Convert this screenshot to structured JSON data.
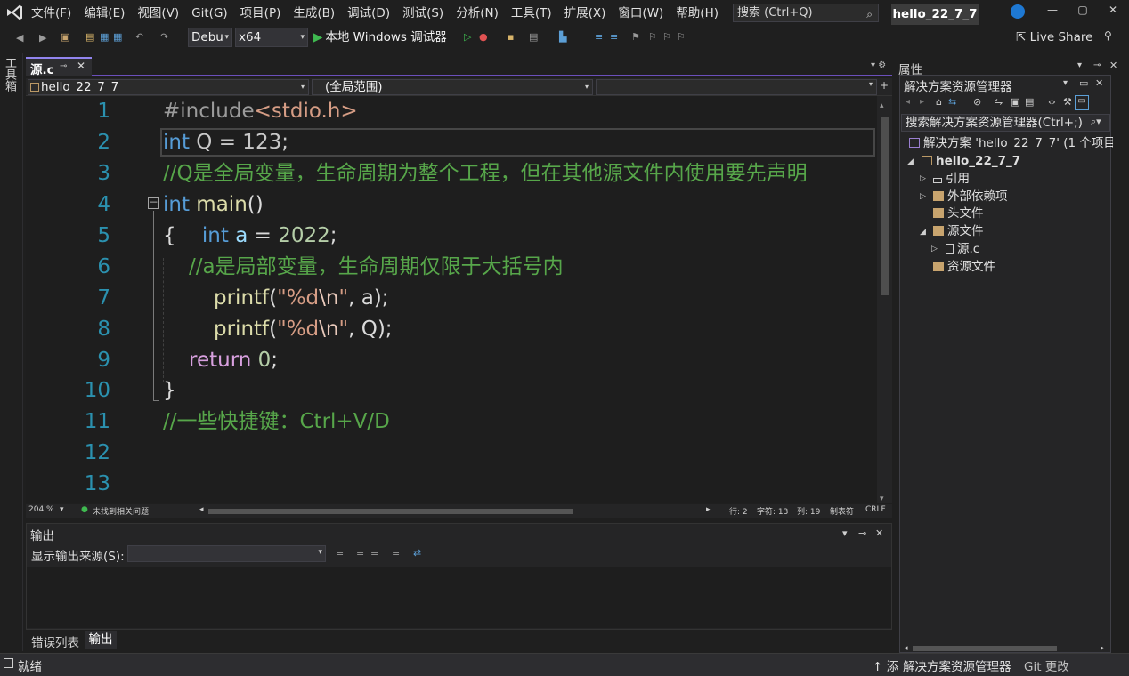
{
  "menubar": {
    "items": [
      "文件(F)",
      "编辑(E)",
      "视图(V)",
      "Git(G)",
      "项目(P)",
      "生成(B)",
      "调试(D)",
      "测试(S)",
      "分析(N)",
      "工具(T)",
      "扩展(X)",
      "窗口(W)",
      "帮助(H)"
    ],
    "search_label": "搜索 (Ctrl+Q)",
    "solution_name": "hello_22_7_7"
  },
  "toolbar": {
    "config": "Debu",
    "platform": "x64",
    "run_label": "本地 Windows 调试器",
    "live_share": "Live Share"
  },
  "toolbox_label": "工具箱",
  "editor": {
    "tab_title": "源.c",
    "nav_project": "hello_22_7_7",
    "nav_scope": "(全局范围)",
    "line_numbers": [
      "1",
      "2",
      "3",
      "4",
      "5",
      "6",
      "7",
      "8",
      "9",
      "10",
      "11",
      "12",
      "13"
    ],
    "tokens": {
      "l1_pre": "#include",
      "l1_inc": "<stdio.h>",
      "l2_kw": "int",
      "l2_rest": " Q = 123;",
      "l3_cmt": "//Q是全局变量，生命周期为整个工程，但在其他源文件内使用要先声明",
      "l4_kw": "int",
      "l4_fn": " main",
      "l4_rest": "()",
      "l5_brace": "{",
      "l5_kw": "int",
      "l5_var": " a",
      "l5_eq": " = ",
      "l5_num": "2022",
      "l5_semi": ";",
      "l6_cmt": "//a是局部变量，生命周期仅限于大括号内",
      "printf": "printf",
      "open": "(",
      "str_q1": "\"%d",
      "esc": "\\n",
      "str_q2": "\"",
      "l7_args": ", a);",
      "l8_args": ", Q);",
      "l9_ret": "return",
      "l9_num": " 0",
      "l9_semi": ";",
      "l10_brace": "}",
      "l11_cmt": "//一些快捷键：Ctrl+V/D"
    },
    "status": {
      "zoom": "204 %",
      "issues": "未找到相关问题",
      "line": "行: 2",
      "char": "字符: 13",
      "col": "列: 19",
      "mode": "制表符",
      "eol": "CRLF"
    }
  },
  "output": {
    "title": "输出",
    "source_label": "显示输出来源(S):"
  },
  "bottom_tabs": [
    "错误列表",
    "输出"
  ],
  "properties_title": "属性",
  "solution_explorer": {
    "title": "解决方案资源管理器",
    "search": "搜索解决方案资源管理器(Ctrl+;)",
    "tree": [
      "解决方案 'hello_22_7_7' (1 个项目",
      "hello_22_7_7",
      "引用",
      "外部依赖项",
      "头文件",
      "源文件",
      "源.c",
      "资源文件"
    ]
  },
  "statusbar": {
    "ready": "就绪",
    "add": "↑ 添",
    "se": "解决方案资源管理器",
    "git": "Git 更改"
  },
  "colors": {
    "keyword": "#569cd6",
    "comment": "#57a64a",
    "function": "#dcdcaa",
    "string": "#d69d85",
    "line_number": "#2b91af",
    "accent": "#9184ee"
  }
}
